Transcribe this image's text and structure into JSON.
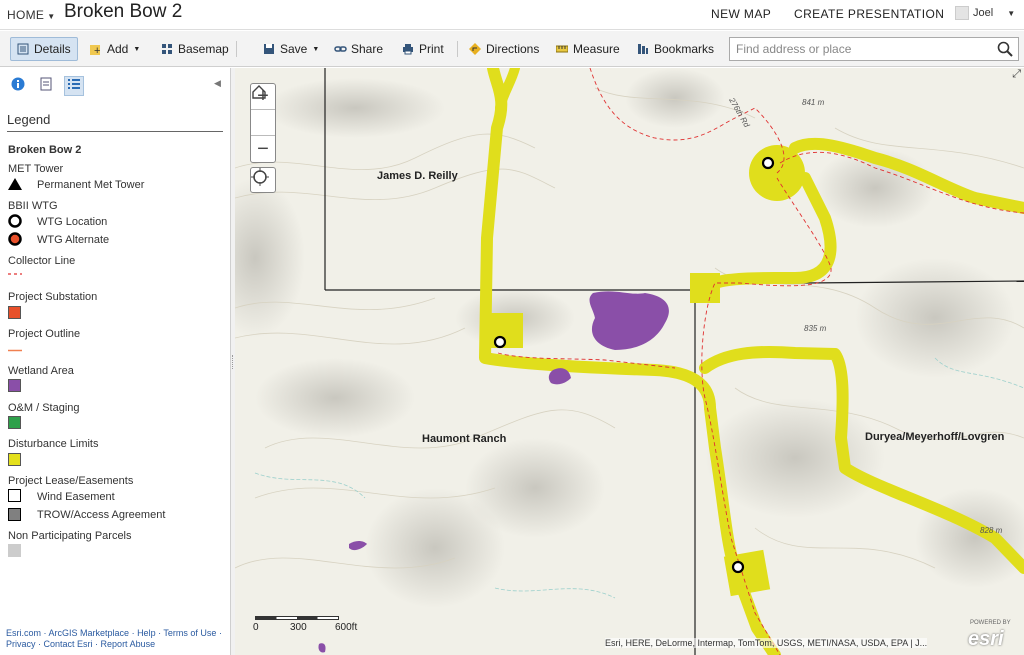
{
  "header": {
    "home_label": "HOME",
    "title": "Broken Bow 2",
    "new_map": "NEW MAP",
    "create_presentation": "CREATE PRESENTATION",
    "user_name": "Joel"
  },
  "toolbar": {
    "details": "Details",
    "add": "Add",
    "basemap": "Basemap",
    "save": "Save",
    "share": "Share",
    "print": "Print",
    "directions": "Directions",
    "measure": "Measure",
    "bookmarks": "Bookmarks",
    "search_placeholder": "Find address or place"
  },
  "sidebar": {
    "legend_title": "Legend",
    "map_name": "Broken Bow 2",
    "layers": {
      "met_tower": "MET Tower",
      "permanent_met_tower": "Permanent Met Tower",
      "bbii_wtg": "BBII WTG",
      "wtg_location": "WTG Location",
      "wtg_alternate": "WTG Alternate",
      "collector_line": "Collector Line",
      "project_substation": "Project Substation",
      "project_outline": "Project Outline",
      "wetland_area": "Wetland Area",
      "om_staging": "O&M / Staging",
      "disturbance_limits": "Disturbance Limits",
      "project_lease": "Project Lease/Easements",
      "wind_easement": "Wind Easement",
      "trow_access": "TROW/Access Agreement",
      "non_participating": "Non Participating Parcels"
    },
    "colors": {
      "substation": "#e8502a",
      "outline": "#f08050",
      "wetland": "#8a4fa8",
      "staging": "#2ea04a",
      "disturbance": "#e4e01c",
      "trow": "#808080",
      "non_participating": "#cccccc",
      "collector": "#e03030"
    },
    "footer": {
      "esri": "Esri.com",
      "marketplace": "ArcGIS Marketplace",
      "help": "Help",
      "terms": "Terms of Use",
      "privacy": "Privacy",
      "contact": "Contact Esri",
      "report": "Report Abuse"
    }
  },
  "map": {
    "parcels": {
      "reilly": "James D. Reilly",
      "haumont": "Haumont Ranch",
      "duryea": "Duryea/Meyerhoff/Lovgren"
    },
    "elevations": {
      "e841": "841 m",
      "e835": "835 m",
      "e828": "828 m",
      "road": "276th Rd"
    },
    "scale": {
      "t0": "0",
      "t300": "300",
      "t600": "600ft"
    },
    "attribution": "Esri, HERE, DeLorme, Intermap, TomTom, USGS, METI/NASA, USDA, EPA | J...",
    "logo_powered": "POWERED BY",
    "logo": "esri"
  }
}
